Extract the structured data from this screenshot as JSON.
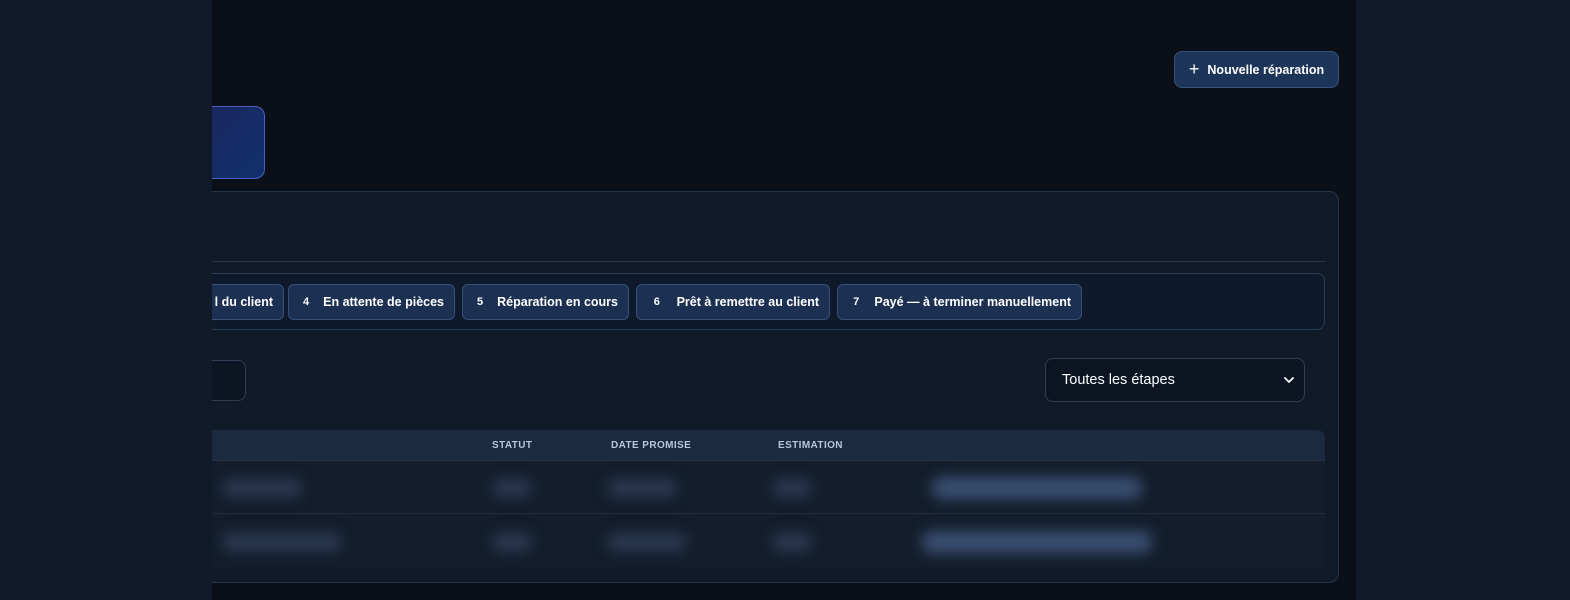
{
  "header": {
    "new_button_label": "Nouvelle réparation",
    "new_button_icon": "plus-icon"
  },
  "stages": [
    {
      "num": "",
      "label": "l du client"
    },
    {
      "num": "4",
      "label": "En attente de pièces"
    },
    {
      "num": "5",
      "label": "Réparation en cours"
    },
    {
      "num": "6",
      "label": "Prêt à remettre au client"
    },
    {
      "num": "7",
      "label": "Payé — à terminer manuellement"
    }
  ],
  "filter": {
    "selected": "Toutes les étapes"
  },
  "table": {
    "columns": [
      "STATUT",
      "DATE PROMISE",
      "ESTIMATION"
    ]
  },
  "colors": {
    "accent": "#1d3558",
    "panel": "#111a29",
    "background": "#0b0f18"
  }
}
